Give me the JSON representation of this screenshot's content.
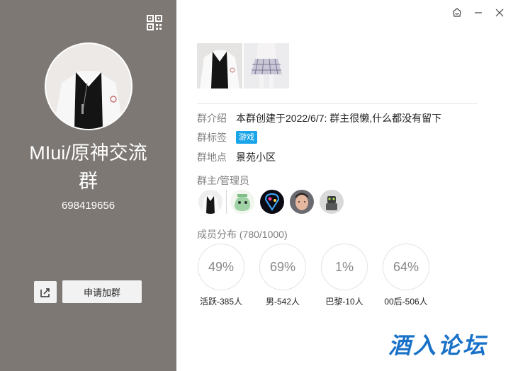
{
  "group": {
    "name_line1": "MIui/原神交流",
    "name_line2": "群",
    "id": "698419656"
  },
  "actions": {
    "join_label": "申请加群"
  },
  "info": {
    "intro_label": "群介绍",
    "intro_value": "本群创建于2022/6/7: 群主很懒,什么都没有留下",
    "tag_label": "群标签",
    "tag_value": "游戏",
    "location_label": "群地点",
    "location_value": "景苑小区"
  },
  "admins": {
    "title": "群主/管理员"
  },
  "distribution": {
    "title": "成员分布",
    "count": "(780/1000)",
    "stats": [
      {
        "percent": "49%",
        "label": "活跃-385人"
      },
      {
        "percent": "69%",
        "label": "男-542人"
      },
      {
        "percent": "1%",
        "label": "巴黎-10人"
      },
      {
        "percent": "64%",
        "label": "00后-506人"
      }
    ]
  },
  "watermark": "酒入论坛",
  "colors": {
    "left_panel": "#7d7874",
    "tag": "#1aa4e9"
  },
  "icons": [
    "qr-code-icon",
    "share-icon",
    "skin-icon",
    "minimize-icon",
    "close-icon"
  ]
}
